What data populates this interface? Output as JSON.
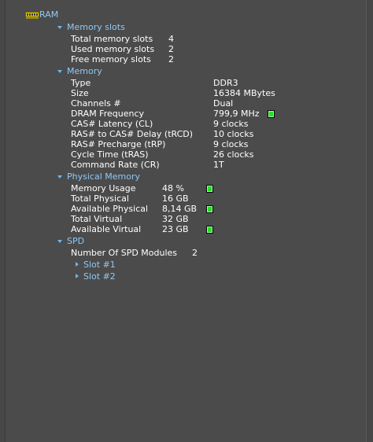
{
  "root": {
    "label": "RAM",
    "icon": "ram-module-icon"
  },
  "memory_slots": {
    "header": "Memory slots",
    "rows": [
      {
        "label": "Total memory slots",
        "value": "4"
      },
      {
        "label": "Used memory slots",
        "value": "2"
      },
      {
        "label": "Free memory slots",
        "value": "2"
      }
    ]
  },
  "memory": {
    "header": "Memory",
    "rows": [
      {
        "label": "Type",
        "value": "DDR3"
      },
      {
        "label": "Size",
        "value": "16384 MBytes"
      },
      {
        "label": "Channels #",
        "value": "Dual"
      },
      {
        "label": "DRAM Frequency",
        "value": "799,9 MHz"
      },
      {
        "label": "CAS# Latency (CL)",
        "value": "9 clocks"
      },
      {
        "label": "RAS# to CAS# Delay (tRCD)",
        "value": "10 clocks"
      },
      {
        "label": "RAS# Precharge (tRP)",
        "value": "9 clocks"
      },
      {
        "label": "Cycle Time (tRAS)",
        "value": "26 clocks"
      },
      {
        "label": "Command Rate (CR)",
        "value": "1T"
      }
    ]
  },
  "physical_memory": {
    "header": "Physical Memory",
    "rows": [
      {
        "label": "Memory Usage",
        "value": "48 %"
      },
      {
        "label": "Total Physical",
        "value": "16 GB"
      },
      {
        "label": "Available Physical",
        "value": "8,14 GB"
      },
      {
        "label": "Total Virtual",
        "value": "32 GB"
      },
      {
        "label": "Available Virtual",
        "value": "23 GB"
      }
    ]
  },
  "spd": {
    "header": "SPD",
    "modules_label": "Number Of SPD Modules",
    "modules_value": "2",
    "slots": [
      "Slot #1",
      "Slot #2"
    ]
  },
  "colors": {
    "background": "#4b4b4b",
    "text": "#ffffff",
    "link": "#8fc8f5",
    "indicator": "#22e322"
  }
}
